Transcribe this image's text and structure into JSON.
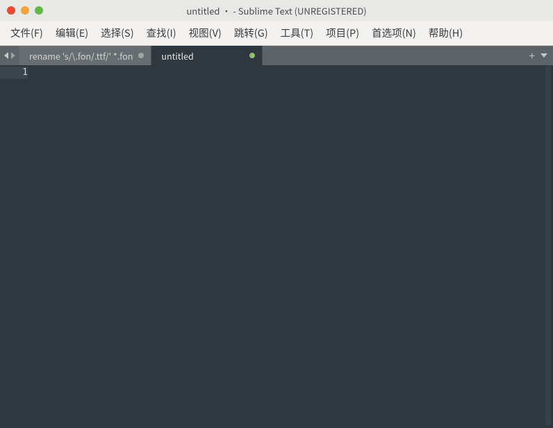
{
  "titlebar": {
    "title": "untitled • - Sublime Text (UNREGISTERED)"
  },
  "menu": {
    "file": "文件(F)",
    "edit": "编辑(E)",
    "select": "选择(S)",
    "find": "查找(I)",
    "view": "视图(V)",
    "goto": "跳转(G)",
    "tools": "工具(T)",
    "project": "项目(P)",
    "prefs": "首选项(N)",
    "help": "帮助(H)"
  },
  "tabs": [
    {
      "label": "rename 's/\\.fon/.ttf/' *.fon",
      "active": false,
      "dirty": "gray"
    },
    {
      "label": "untitled",
      "active": true,
      "dirty": "green"
    }
  ],
  "tab_actions": {
    "new_tab": "+"
  },
  "editor": {
    "line_numbers": [
      "1"
    ],
    "content": ""
  }
}
